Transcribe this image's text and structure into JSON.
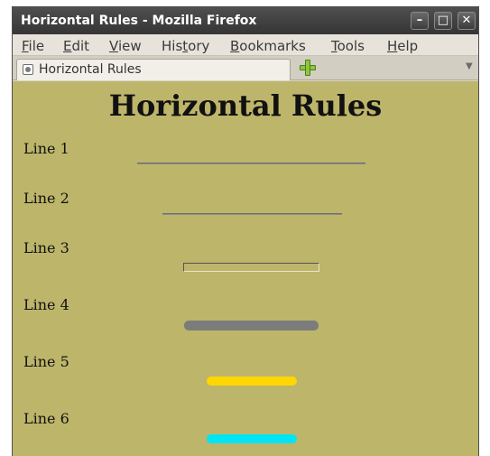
{
  "window": {
    "title": "Horizontal Rules - Mozilla Firefox",
    "minimize_glyph": "–",
    "maximize_glyph": "□",
    "close_glyph": "✕"
  },
  "menu": {
    "items": [
      {
        "first": "F",
        "rest": "ile"
      },
      {
        "first": "E",
        "rest": "dit"
      },
      {
        "first": "V",
        "rest": "iew"
      },
      {
        "first": "His",
        "ul": "t",
        "rest": "ory"
      },
      {
        "first": "B",
        "rest": "ookmarks"
      },
      {
        "first": "T",
        "rest": "ools"
      },
      {
        "first": "H",
        "rest": "elp"
      }
    ]
  },
  "tabs": {
    "active_title": "Horizontal Rules",
    "tab_list_glyph": "▼"
  },
  "page": {
    "heading": "Horizontal Rules",
    "lines": [
      "Line 1",
      "Line 2",
      "Line 3",
      "Line 4",
      "Line 5",
      "Line 6"
    ]
  },
  "colors": {
    "page_background": "#bdb56a",
    "rule_gray": "#7c7c7c",
    "rule_gold": "#ffd700",
    "rule_cyan": "#00e5f5"
  }
}
